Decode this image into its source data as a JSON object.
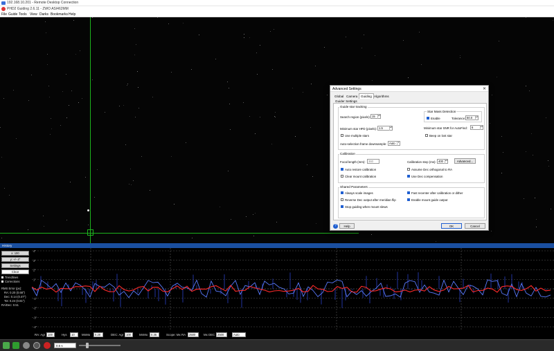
{
  "remote_window": {
    "title": "192.168.10.201 - Remote Desktop Connection"
  },
  "app": {
    "title": "PHD2 Guiding 2.6.11 - ZWO ASI462MM"
  },
  "menu": [
    "File",
    "Guide",
    "Tools",
    "View",
    "Darks",
    "Bookmarks",
    "Help"
  ],
  "dialog": {
    "title": "Advanced Settings",
    "tabs": [
      "Global",
      "Camera",
      "Guiding",
      "Algorithms"
    ],
    "active_tab": "Guiding",
    "subtab": "Guider Settings",
    "star_tracking": {
      "title": "Guide star tracking",
      "search_region_label": "Search region (pixels):",
      "search_region_value": "15",
      "min_hfd_label": "Minimum star HFD (pixels):",
      "min_hfd_value": "1.5",
      "use_multiple_stars_label": "Use multiple stars",
      "use_multiple_stars_checked": false,
      "autosel_label": "Auto-selection frame downsample:",
      "autosel_value": "Auto",
      "mass_title": "Star Mass Detection",
      "mass_enable_label": "Enable",
      "mass_enable_checked": true,
      "tolerance_label": "Tolerance:",
      "tolerance_value": "50.0",
      "min_snr_label": "Minimum star SNR for AutoFind:",
      "min_snr_value": "6",
      "beep_label": "Beep on lost star",
      "beep_checked": false
    },
    "calibration": {
      "title": "Calibration",
      "focal_length_label": "Focal length (mm):",
      "focal_length_value": "360",
      "cal_step_label": "Calibration step (ms):",
      "cal_step_value": "400",
      "advanced_label": "Advanced...",
      "auto_restore_label": "Auto restore calibration",
      "auto_restore_checked": true,
      "assume_dec_label": "Assume Dec orthogonal to RA",
      "assume_dec_checked": false,
      "clear_mount_label": "Clear mount calibration",
      "clear_mount_checked": false,
      "use_dec_comp_label": "Use Dec compensation",
      "use_dec_comp_checked": true
    },
    "shared": {
      "title": "Shared Parameters",
      "always_scale_label": "Always scale images",
      "always_scale_checked": true,
      "fast_recenter_label": "Fast recenter after calibration or dither",
      "fast_recenter_checked": true,
      "reverse_dec_label": "Reverse Dec output after meridian flip",
      "reverse_dec_checked": false,
      "enable_mount_label": "Enable mount guide output",
      "enable_mount_checked": true,
      "stop_guiding_label": "Stop guiding when mount slews",
      "stop_guiding_checked": true
    },
    "help_label": "Help",
    "ok_label": "OK",
    "cancel_label": "Cancel"
  },
  "history": {
    "title": "History",
    "x_scale": "x: 100",
    "y_scale": "y: +/- 4\"",
    "settings_label": "Settings",
    "clear_label": "Clear",
    "trendlines_label": "Trendlines",
    "corrections_label": "Corrections",
    "rms_title": "RMS Error (px):",
    "rms_ra": "RA: 0.20 (0.68\")",
    "rms_dec": "Dec: 0.14 (0.47\")",
    "rms_tot": "Tot: 0.24 (0.81\")",
    "ra_dec_ratio": "RA/Dec: 0.51",
    "y_ticks": [
      "4\"",
      "3\"",
      "2\"",
      "1\"",
      "0\"",
      "-1\"",
      "-2\"",
      "-3\"",
      "-4\""
    ],
    "colors": {
      "ra": "#5a7bff",
      "dec": "#ff2a2a",
      "grid": "#555555"
    }
  },
  "guide_params": {
    "ra_agr_label": "RA: Agr",
    "ra_agr_value": "100",
    "hys_label": "Hys",
    "hys_value": "10",
    "minmo_label": "MnMo",
    "minmo_value": "0.20",
    "dec_agr_label": "DEC: Agr",
    "dec_agr_value": "100",
    "dec_minmo_label": "MnMo",
    "dec_minmo_value": "0.35",
    "scope_label": "Scope: Mx RA",
    "mx_ra_value": "2500",
    "mx_dec_label": "Mx DEC",
    "mx_dec_value": "2500",
    "dec_mode_value": "Auto"
  },
  "toolbar": {
    "exposure_value": "0.5 s"
  }
}
